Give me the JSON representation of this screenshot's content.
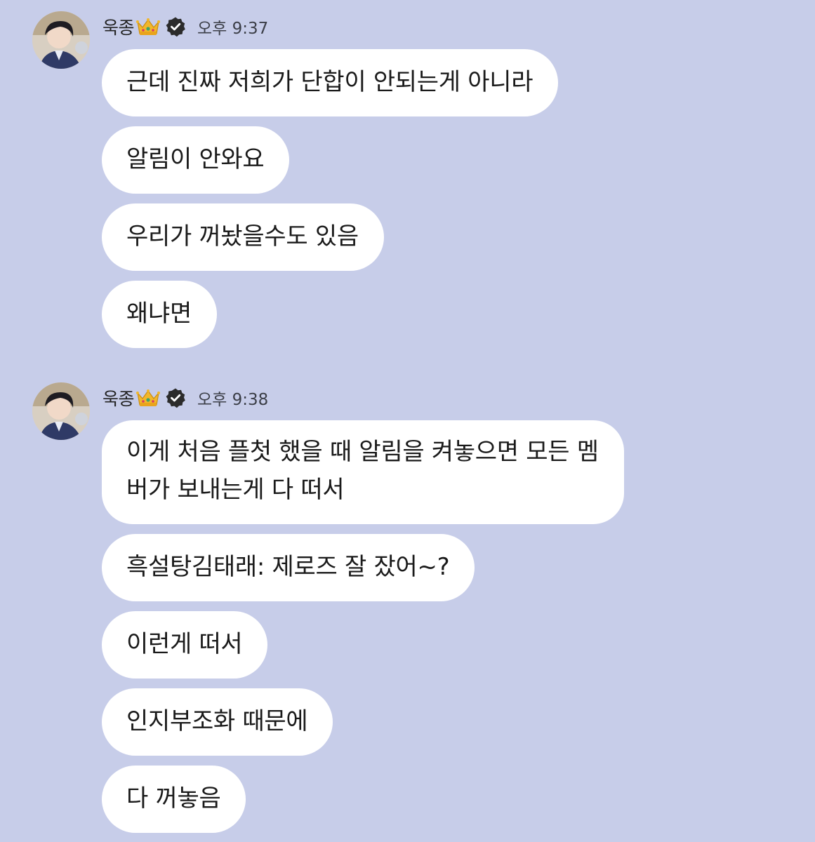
{
  "groups": [
    {
      "sender": "욱종",
      "time": "오후 9:37",
      "messages": [
        "근데 진짜 저희가 단합이 안되는게 아니라",
        "알림이 안와요",
        "우리가 꺼놨을수도 있음",
        "왜냐면"
      ]
    },
    {
      "sender": "욱종",
      "time": "오후 9:38",
      "messages": [
        "이게 처음 플첫 했을 때 알림을 켜놓으면 모든 멤\n버가 보내는게 다 떠서",
        "흑설탕김태래: 제로즈 잘 잤어~?",
        "이런게 떠서",
        "인지부조화 때문에",
        "다 꺼놓음"
      ]
    }
  ],
  "colors": {
    "background": "#c7cde9",
    "bubble": "#ffffff",
    "crown": "#f2b72a",
    "verified": "#2b2b2b"
  },
  "icons": {
    "crown": "crown-emoji-icon",
    "verified": "verified-badge-icon"
  }
}
